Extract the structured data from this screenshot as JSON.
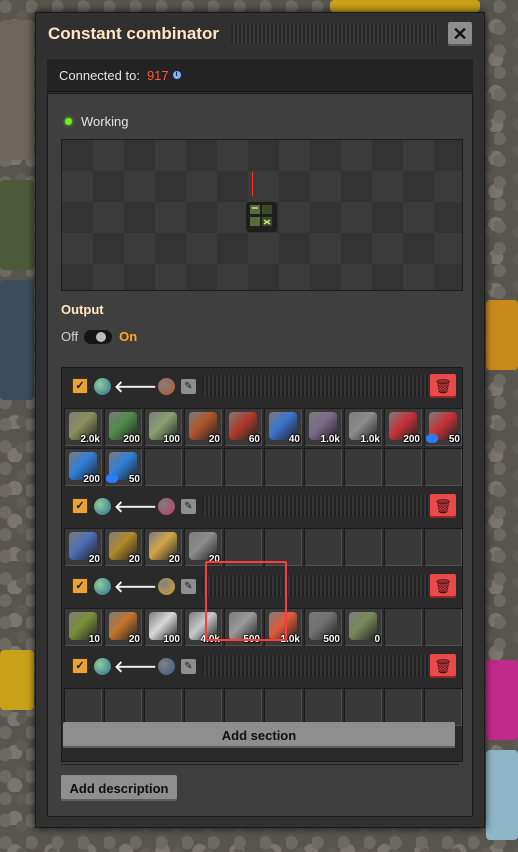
{
  "window": {
    "title": "Constant combinator",
    "close_icon": "close-icon"
  },
  "connection": {
    "label": "Connected to:",
    "value": "917"
  },
  "status": {
    "text": "Working",
    "color": "#6cf022"
  },
  "output": {
    "label": "Output",
    "off_label": "Off",
    "on_label": "On",
    "state": "on"
  },
  "sections": [
    {
      "items": [
        {
          "icon": "speed-module-icon",
          "count": "2.0k",
          "color": "#8a8f5a"
        },
        {
          "icon": "green-pipe-icon",
          "count": "200",
          "color": "#4f8a4a"
        },
        {
          "icon": "spring-icon",
          "count": "100",
          "color": "#8aa070"
        },
        {
          "icon": "foundry-icon",
          "count": "20",
          "color": "#b0542a"
        },
        {
          "icon": "red-machine-icon",
          "count": "60",
          "color": "#b03a2a"
        },
        {
          "icon": "blue-capsule-icon",
          "count": "40",
          "color": "#3a72d0"
        },
        {
          "icon": "rail-icon",
          "count": "1.0k",
          "color": "#7a6a88"
        },
        {
          "icon": "bolts-icon",
          "count": "1.0k",
          "color": "#8c8c8c"
        },
        {
          "icon": "red-circuit-icon",
          "count": "200",
          "color": "#c8323a"
        },
        {
          "icon": "red-circuit-quality-icon",
          "count": "50",
          "color": "#c8323a",
          "quality": true
        },
        {
          "icon": "blue-circuit-icon",
          "count": "200",
          "color": "#2f7fd9"
        },
        {
          "icon": "blue-circuit-quality-icon",
          "count": "50",
          "color": "#2f7fd9",
          "quality": true
        },
        {},
        {},
        {},
        {},
        {},
        {},
        {},
        {}
      ]
    },
    {
      "items": [
        {
          "icon": "electromagnetic-plant-icon",
          "count": "20",
          "color": "#4b6fb5"
        },
        {
          "icon": "biolab-icon",
          "count": "20",
          "color": "#b08a2a"
        },
        {
          "icon": "turbine-icon",
          "count": "20",
          "color": "#d1a64a"
        },
        {
          "icon": "spider-icon",
          "count": "20",
          "color": "#8c8c8c"
        },
        {},
        {},
        {},
        {},
        {},
        {}
      ]
    },
    {
      "items": [
        {
          "icon": "tank-icon",
          "count": "10",
          "color": "#7a8f3a"
        },
        {
          "icon": "rocket-part-icon",
          "count": "20",
          "color": "#c2752a"
        },
        {
          "icon": "bone-icon",
          "count": "100",
          "color": "#d8d8d8"
        },
        {
          "icon": "plate-icon",
          "count": "4.0k",
          "color": "#c9c9c9"
        },
        {
          "icon": "steel-plate-icon",
          "count": "500",
          "color": "#9a9a9a"
        },
        {
          "icon": "nutrient-icon",
          "count": "1.0k",
          "color": "#e05a3a"
        },
        {
          "icon": "iron-bar-icon",
          "count": "500",
          "color": "#6f6f6f"
        },
        {
          "icon": "fish-egg-icon",
          "count": "0",
          "color": "#7a8a5a"
        },
        {},
        {}
      ]
    },
    {
      "items": [
        {},
        {},
        {},
        {},
        {},
        {},
        {},
        {},
        {},
        {}
      ]
    }
  ],
  "buttons": {
    "add_section": "Add section",
    "add_description": "Add description"
  }
}
